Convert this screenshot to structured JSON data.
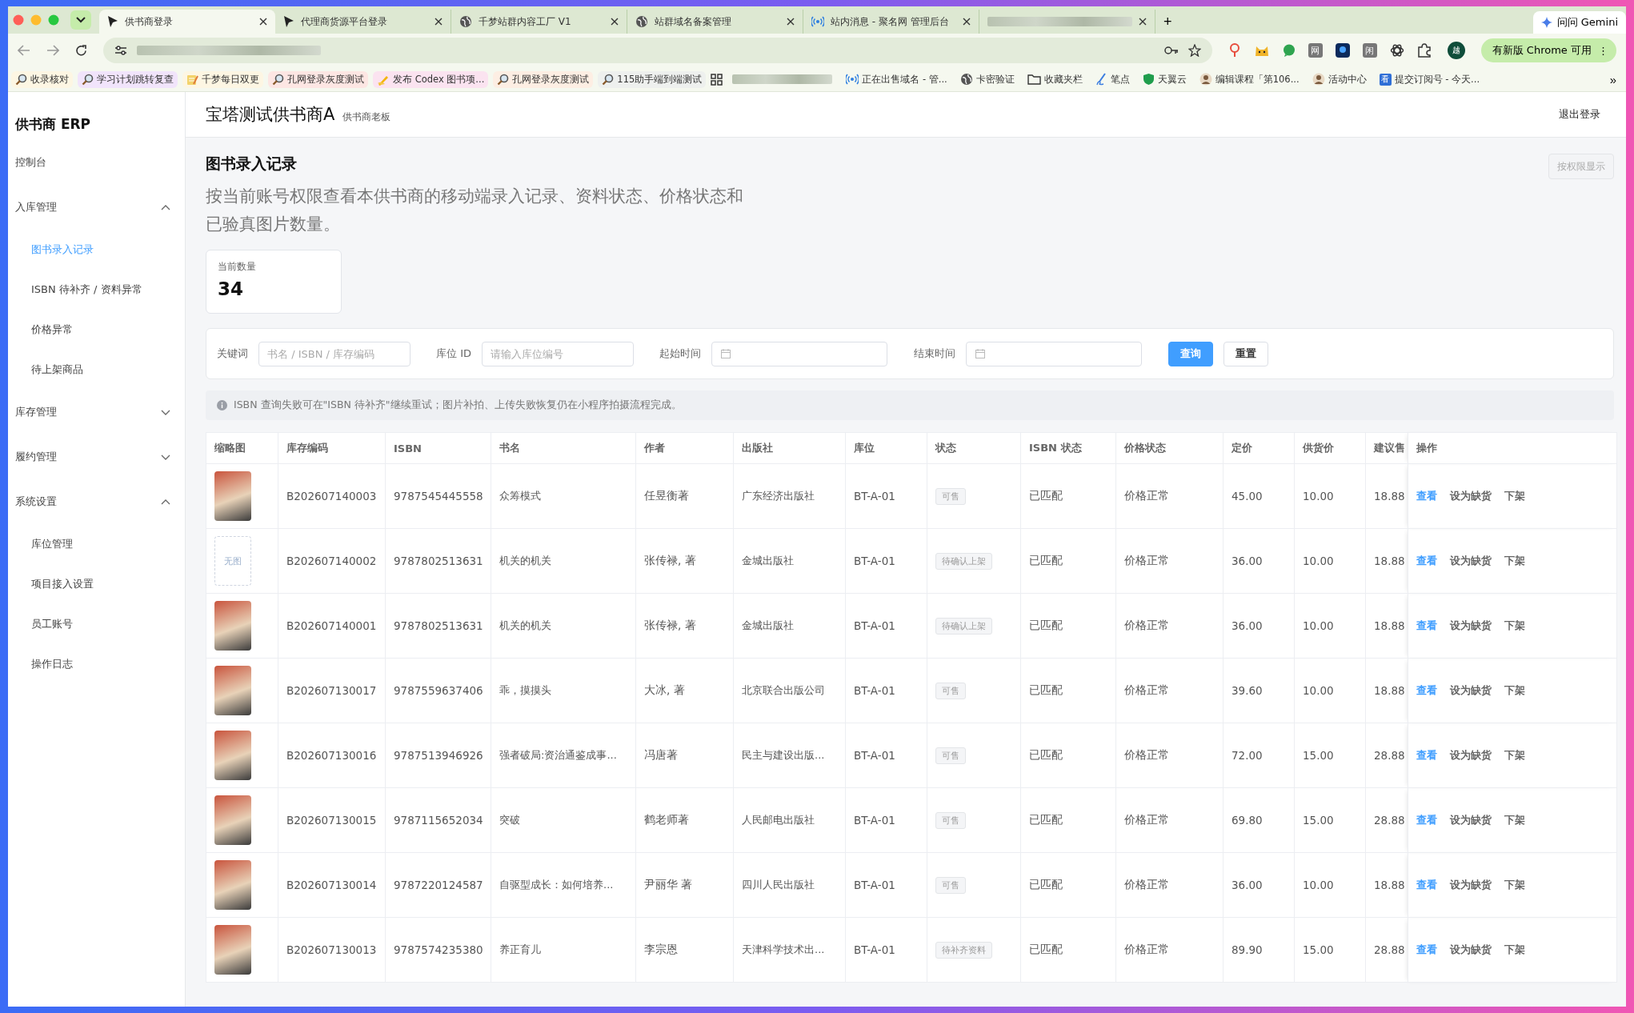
{
  "browser": {
    "tabs": [
      {
        "kind": "cursor",
        "title": "供书商登录",
        "selected": true
      },
      {
        "kind": "cursor",
        "title": "代理商货源平台登录",
        "selected": false
      },
      {
        "kind": "globe",
        "title": "千梦站群内容工厂 V1",
        "selected": false
      },
      {
        "kind": "globe",
        "title": "站群域名备案管理",
        "selected": false
      },
      {
        "kind": "signal",
        "title": "站内消息 - 聚名网 管理后台",
        "selected": false
      },
      {
        "kind": "redacted",
        "selected": false
      }
    ],
    "new_tab": "+",
    "gemini": "问问 Gemini",
    "extensions": [
      {
        "kind": "pin"
      },
      {
        "kind": "cat"
      },
      {
        "kind": "chat"
      },
      {
        "kind": "text",
        "label": "网"
      },
      {
        "kind": "square"
      },
      {
        "kind": "text",
        "label": "闲"
      },
      {
        "kind": "knot"
      },
      {
        "kind": "puzzle"
      }
    ],
    "profile": "越",
    "update_button": "有新版 Chrome 可用",
    "update_menu": "⋮",
    "bookmarks": [
      {
        "kind": "magnifier",
        "label": "收录核对",
        "color": "#fdf6e3"
      },
      {
        "kind": "magnifier",
        "label": "学习计划跳转复查",
        "color": "#f1e4fb"
      },
      {
        "kind": "note",
        "label": "千梦每日双更",
        "color": "#fdf6e3"
      },
      {
        "kind": "magnifier",
        "label": "孔网登录灰度测试",
        "color": "#fde6e3"
      },
      {
        "kind": "pencil",
        "label": "发布 Codex 图书项...",
        "color": "#fbe3f0"
      },
      {
        "kind": "magnifier",
        "label": "孔网登录灰度测试",
        "color": "#fdeee3"
      },
      {
        "kind": "magnifier",
        "label": "115助手端到端测试",
        "color": "#eef0ee"
      },
      {
        "kind": "apps"
      },
      {
        "kind": "redacted"
      },
      {
        "kind": "signal",
        "label": "正在出售域名 - 管..."
      },
      {
        "kind": "globe",
        "label": "卡密验证"
      },
      {
        "kind": "folder",
        "label": "收藏夹栏"
      },
      {
        "kind": "brush",
        "label": "笔点"
      },
      {
        "kind": "shield",
        "label": "天翼云"
      },
      {
        "kind": "person",
        "label": "编辑课程「第106..."
      },
      {
        "kind": "person",
        "label": "活动中心"
      },
      {
        "kind": "badge",
        "badge": "看",
        "label": "提交订阅号 - 今天..."
      }
    ],
    "more": "»"
  },
  "app": {
    "brand": "供书商 ERP",
    "nav": [
      {
        "label": "控制台"
      },
      {
        "label": "入库管理",
        "expanded": true,
        "children": [
          {
            "label": "图书录入记录",
            "selected": true
          },
          {
            "label": "ISBN 待补齐 / 资料异常",
            "selected": false
          },
          {
            "label": "价格异常",
            "selected": false
          },
          {
            "label": "待上架商品",
            "selected": false
          }
        ]
      },
      {
        "label": "库存管理",
        "expanded": false
      },
      {
        "label": "履约管理",
        "expanded": false
      },
      {
        "label": "系统设置",
        "expanded": true,
        "children": [
          {
            "label": "库位管理",
            "selected": false
          },
          {
            "label": "项目接入设置",
            "selected": false
          },
          {
            "label": "员工账号",
            "selected": false
          },
          {
            "label": "操作日志",
            "selected": false
          }
        ]
      }
    ],
    "header": {
      "title": "宝塔测试供书商A",
      "role": "供书商老板",
      "logout": "退出登录"
    },
    "page": {
      "title": "图书录入记录",
      "description": "按当前账号权限查看本供书商的移动端录入记录、资料状态、价格状态和已验真图片数量。",
      "permission_button": "按权限显示",
      "stat": {
        "label": "当前数量",
        "value": "34"
      },
      "filters": [
        {
          "kind": "text",
          "label": "关键词",
          "placeholder": "书名 / ISBN / 库存编码"
        },
        {
          "kind": "text",
          "label": "库位 ID",
          "placeholder": "请输入库位编号"
        },
        {
          "kind": "date",
          "label": "起始时间"
        },
        {
          "kind": "date",
          "label": "结束时间"
        }
      ],
      "search_button": "查询",
      "reset_button": "重置",
      "notice": "ISBN 查询失败可在\"ISBN 待补齐\"继续重试；图片补拍、上传失败恢复仍在小程序拍摄流程完成。",
      "table": {
        "columns": [
          "缩略图",
          "库存编码",
          "ISBN",
          "书名",
          "作者",
          "出版社",
          "库位",
          "状态",
          "ISBN 状态",
          "价格状态",
          "定价",
          "供货价",
          "建议售",
          "操作"
        ],
        "rows": [
          {
            "kind": "photo",
            "cells": [
              "",
              "B202607140003",
              "9787545445558",
              "众筹模式",
              "任昱衡著",
              "广东经济出版社",
              "BT-A-01",
              "可售",
              "已匹配",
              "价格正常",
              "45.00",
              "10.00",
              "18.88"
            ],
            "actions": [
              "查看",
              "设为缺货",
              "下架"
            ]
          },
          {
            "kind": "none",
            "cells": [
              "无图",
              "B202607140002",
              "9787802513631",
              "机关的机关",
              "张传禄, 著",
              "金城出版社",
              "BT-A-01",
              "待确认上架",
              "已匹配",
              "价格正常",
              "36.00",
              "10.00",
              "18.88"
            ],
            "actions": [
              "查看",
              "设为缺货",
              "下架"
            ]
          },
          {
            "kind": "photo",
            "cells": [
              "",
              "B202607140001",
              "9787802513631",
              "机关的机关",
              "张传禄, 著",
              "金城出版社",
              "BT-A-01",
              "待确认上架",
              "已匹配",
              "价格正常",
              "36.00",
              "10.00",
              "18.88"
            ],
            "actions": [
              "查看",
              "设为缺货",
              "下架"
            ]
          },
          {
            "kind": "photo",
            "cells": [
              "",
              "B202607130017",
              "9787559637406",
              "乖，摸摸头",
              "大冰, 著",
              "北京联合出版公司",
              "BT-A-01",
              "可售",
              "已匹配",
              "价格正常",
              "39.60",
              "10.00",
              "18.88"
            ],
            "actions": [
              "查看",
              "设为缺货",
              "下架"
            ]
          },
          {
            "kind": "photo",
            "cells": [
              "",
              "B202607130016",
              "9787513946926",
              "强者破局:资治通鉴成事...",
              "冯唐著",
              "民主与建设出版...",
              "BT-A-01",
              "可售",
              "已匹配",
              "价格正常",
              "72.00",
              "15.00",
              "28.88"
            ],
            "actions": [
              "查看",
              "设为缺货",
              "下架"
            ]
          },
          {
            "kind": "photo",
            "cells": [
              "",
              "B202607130015",
              "9787115652034",
              "突破",
              "鹤老师著",
              "人民邮电出版社",
              "BT-A-01",
              "可售",
              "已匹配",
              "价格正常",
              "69.80",
              "15.00",
              "28.88"
            ],
            "actions": [
              "查看",
              "设为缺货",
              "下架"
            ]
          },
          {
            "kind": "photo",
            "cells": [
              "",
              "B202607130014",
              "9787220124587",
              "自驱型成长：如何培养...",
              "尹丽华 著",
              "四川人民出版社",
              "BT-A-01",
              "可售",
              "已匹配",
              "价格正常",
              "36.00",
              "10.00",
              "18.88"
            ],
            "actions": [
              "查看",
              "设为缺货",
              "下架"
            ]
          },
          {
            "kind": "photo",
            "cells": [
              "",
              "B202607130013",
              "9787574235380",
              "养正育儿",
              "李宗恩",
              "天津科学技术出...",
              "BT-A-01",
              "待补齐资料",
              "已匹配",
              "价格正常",
              "89.90",
              "15.00",
              "28.88"
            ],
            "actions": [
              "查看",
              "设为缺货",
              "下架"
            ]
          }
        ]
      }
    }
  }
}
